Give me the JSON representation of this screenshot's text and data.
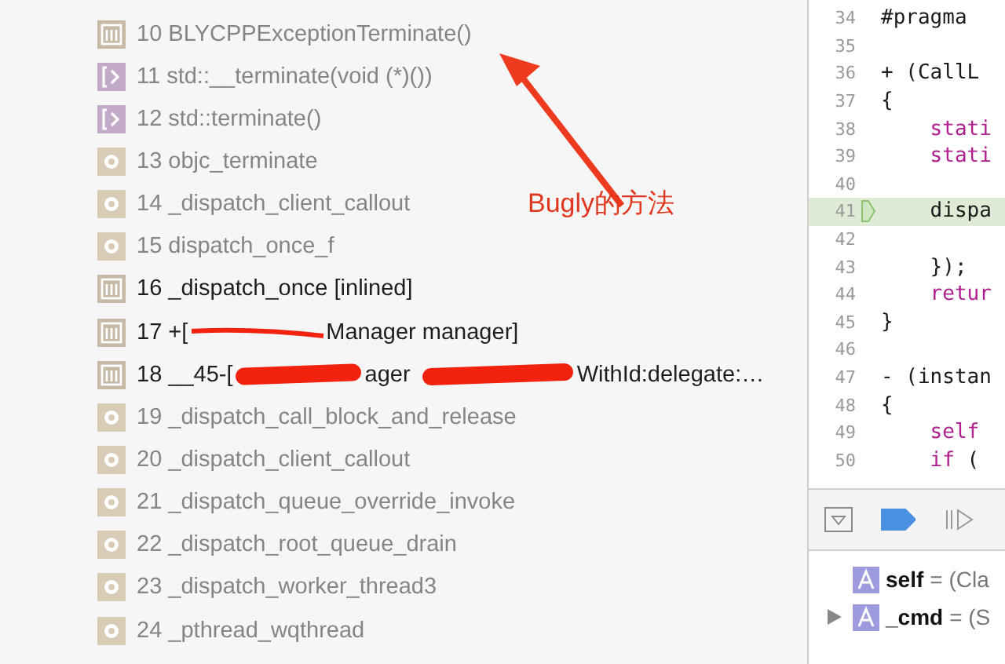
{
  "frames": [
    {
      "text": "10 BLYCPPExceptionTerminate()",
      "kind": "library",
      "dimmed": true
    },
    {
      "text": "11 std::__terminate(void (*)())",
      "kind": "cpp",
      "dimmed": true
    },
    {
      "text": "12 std::terminate()",
      "kind": "cpp",
      "dimmed": true
    },
    {
      "text": "13 objc_terminate",
      "kind": "system",
      "dimmed": true
    },
    {
      "text": "14 _dispatch_client_callout",
      "kind": "system",
      "dimmed": true
    },
    {
      "text": "15 dispatch_once_f",
      "kind": "system",
      "dimmed": true
    },
    {
      "text": "16 _dispatch_once [inlined]",
      "kind": "library",
      "dimmed": false
    },
    {
      "parts": [
        "17 +[",
        "Manager manager]"
      ],
      "kind": "library",
      "dimmed": false,
      "scribbled": true
    },
    {
      "parts": [
        "18 __45-[",
        "ager",
        "WithId:delegate:…"
      ],
      "kind": "library",
      "dimmed": false
    },
    {
      "text": "19 _dispatch_call_block_and_release",
      "kind": "system",
      "dimmed": true
    },
    {
      "text": "20 _dispatch_client_callout",
      "kind": "system",
      "dimmed": true
    },
    {
      "text": "21 _dispatch_queue_override_invoke",
      "kind": "system",
      "dimmed": true
    },
    {
      "text": "22 _dispatch_root_queue_drain",
      "kind": "system",
      "dimmed": true
    },
    {
      "text": "23 _dispatch_worker_thread3",
      "kind": "system",
      "dimmed": true
    },
    {
      "text": "24 _pthread_wqthread",
      "kind": "system",
      "dimmed": true
    }
  ],
  "annotation": {
    "text": "Bugly的方法"
  },
  "editor": {
    "lines": [
      {
        "number": "34",
        "current": false,
        "tokens": [
          {
            "text": "#pragma",
            "kind": "plain"
          }
        ]
      },
      {
        "number": "35",
        "current": false
      },
      {
        "number": "36",
        "current": false,
        "tokens": [
          {
            "text": "+ (CallL",
            "kind": "plain"
          }
        ]
      },
      {
        "number": "37",
        "current": false,
        "tokens": [
          {
            "text": "{",
            "kind": "plain"
          }
        ]
      },
      {
        "number": "38",
        "current": false,
        "tokens": [
          {
            "text": "    stati",
            "kind": "keyword"
          }
        ]
      },
      {
        "number": "39",
        "current": false,
        "tokens": [
          {
            "text": "    stati",
            "kind": "keyword"
          }
        ]
      },
      {
        "number": "40",
        "current": false
      },
      {
        "number": "41",
        "current": true,
        "tokens": [
          {
            "text": "    dispa",
            "kind": "plain"
          }
        ]
      },
      {
        "number": "42",
        "current": false
      },
      {
        "number": "43",
        "current": false,
        "tokens": [
          {
            "text": "    });",
            "kind": "plain"
          }
        ]
      },
      {
        "number": "44",
        "current": false,
        "tokens": [
          {
            "text": "    retur",
            "kind": "keyword"
          }
        ]
      },
      {
        "number": "45",
        "current": false,
        "tokens": [
          {
            "text": "}",
            "kind": "plain"
          }
        ]
      },
      {
        "number": "46",
        "current": false
      },
      {
        "number": "47",
        "current": false,
        "tokens": [
          {
            "text": "- (instan",
            "kind": "plain"
          }
        ]
      },
      {
        "number": "48",
        "current": false,
        "tokens": [
          {
            "text": "{",
            "kind": "plain"
          }
        ]
      },
      {
        "number": "49",
        "current": false,
        "tokens": [
          {
            "text": "    self",
            "kind": "keyword"
          }
        ]
      },
      {
        "number": "50",
        "current": false,
        "tokens": [
          {
            "text": "    if",
            "kind": "keyword"
          },
          {
            "text": " (",
            "kind": "plain"
          }
        ]
      }
    ]
  },
  "debug_bar": {
    "breakpoints_active": true
  },
  "variables": [
    {
      "name": "self",
      "value": "= (Cla",
      "expandable": false
    },
    {
      "name": "_cmd",
      "value": "= (S",
      "expandable": true
    }
  ]
}
